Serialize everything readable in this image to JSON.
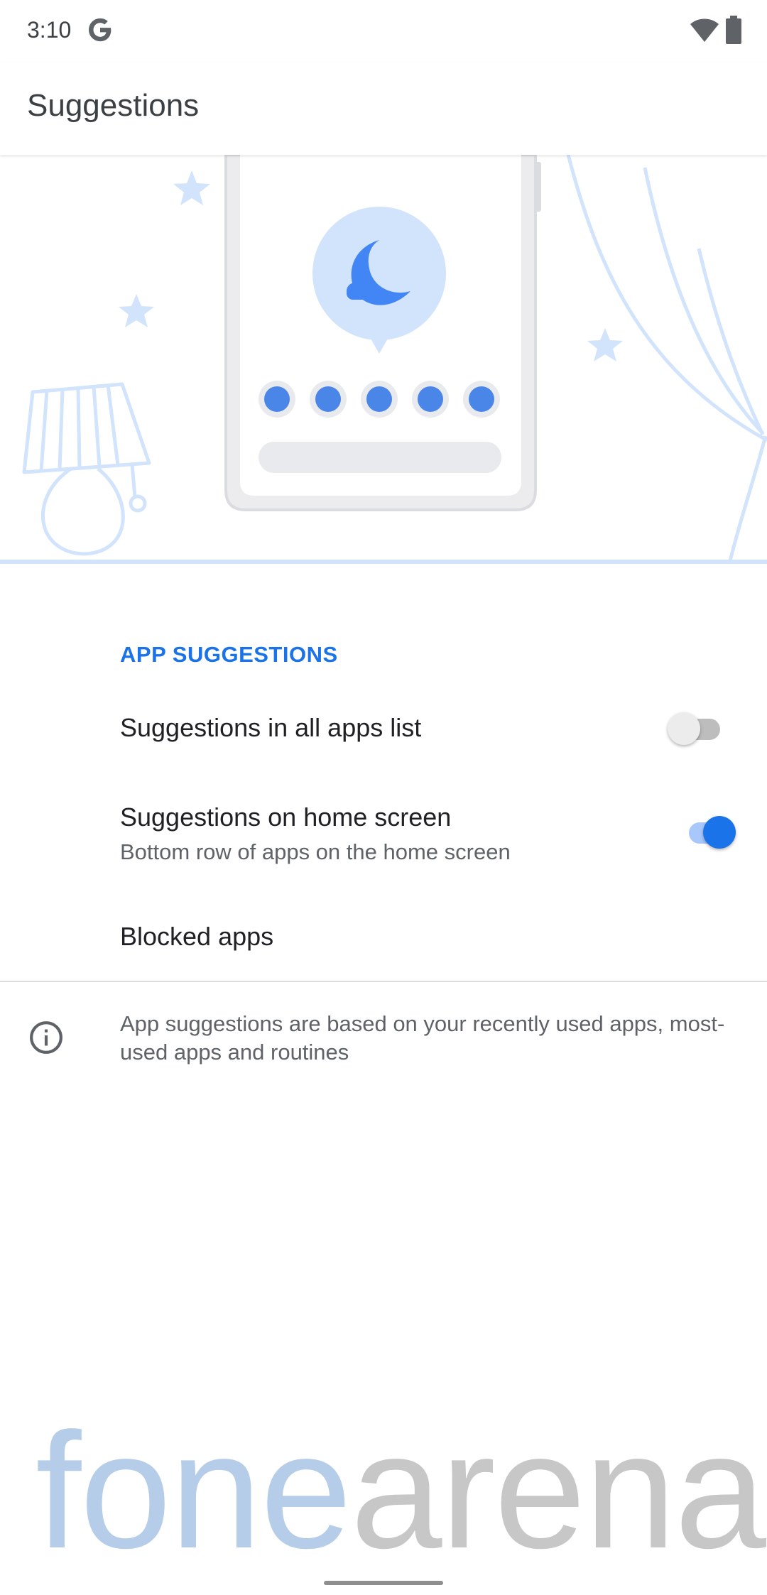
{
  "status_bar": {
    "time": "3:10",
    "g_icon": "google-g-icon",
    "wifi_icon": "wifi-icon",
    "battery_icon": "battery-icon"
  },
  "app_bar": {
    "title": "Suggestions"
  },
  "illustration": {
    "icon": "moon-cloud-icon",
    "dot_count": 5,
    "accent": "#4285f4",
    "light": "#d2e3fc"
  },
  "section": {
    "header": "APP SUGGESTIONS"
  },
  "prefs": {
    "all_apps": {
      "title": "Suggestions in all apps list",
      "checked": false
    },
    "home_screen": {
      "title": "Suggestions on home screen",
      "summary": "Bottom row of apps on the home screen",
      "checked": true
    },
    "blocked": {
      "title": "Blocked apps"
    }
  },
  "footer": {
    "icon": "info-icon",
    "text": "App suggestions are based on your recently used apps, most-used apps and routines"
  },
  "watermark": {
    "part1": "fone",
    "part2": "arena"
  },
  "colors": {
    "accent": "#1a73e8",
    "switch_on_track": "#a8c7fa",
    "text_primary": "#202124",
    "text_secondary": "#5f6368"
  }
}
